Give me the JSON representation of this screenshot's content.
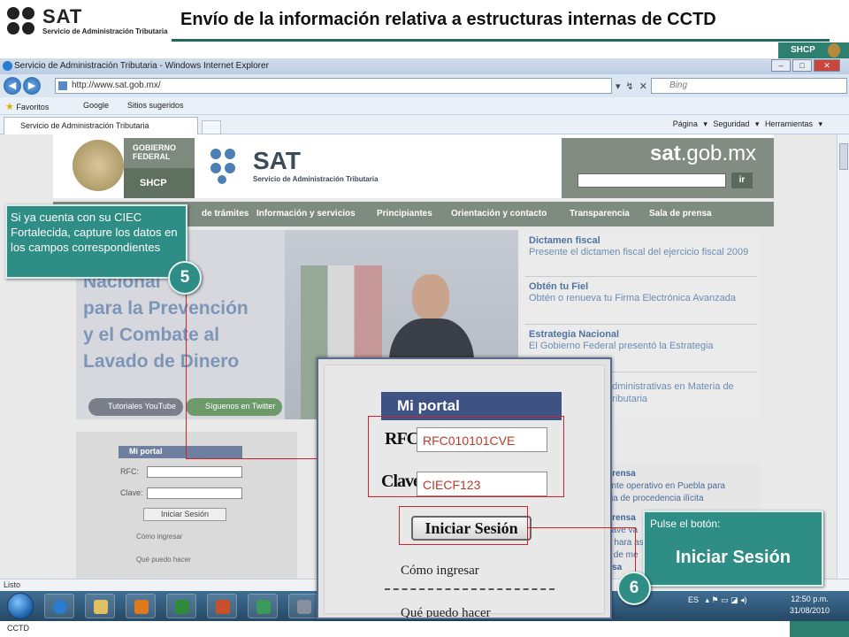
{
  "slide": {
    "logo_word": "SAT",
    "logo_sub": "Servicio de Administración Tributaria",
    "title": "Envío de la información relativa a estructuras internas de CCTD",
    "shcp_badge": "SHCP",
    "footer": "CCTD"
  },
  "browser": {
    "window_title": "Servicio de Administración Tributaria - Windows Internet Explorer",
    "url": "http://www.sat.gob.mx/",
    "search_placeholder": "Bing",
    "favorites": [
      "Favoritos",
      "Google",
      "Sitios sugeridos"
    ],
    "tab_title": "Servicio de Administración Tributaria",
    "command_bar": [
      "Página",
      "Seguridad",
      "Herramientas"
    ],
    "status": "Listo"
  },
  "site": {
    "gov_line1": "GOBIERNO",
    "gov_line2": "FEDERAL",
    "shcp": "SHCP",
    "logo_word": "SAT",
    "logo_sub": "Servicio de Administración Tributaria",
    "domain_bold": "sat",
    "domain_rest": ".gob.mx",
    "search_button": "ir",
    "nav": [
      "de trámites",
      "Información y servicios",
      "Principiantes",
      "Orientación y contacto",
      "Transparencia",
      "Sala de prensa"
    ],
    "hero_lines": [
      "Nacional",
      "para la Prevención",
      "y el Combate al",
      "Lavado de Dinero"
    ],
    "social": [
      "Tutoriales YouTube",
      "Síguenos en Twitter"
    ],
    "promos": [
      {
        "title": "Dictamen fiscal",
        "body": "Presente el dictamen fiscal del ejercicio fiscal 2009"
      },
      {
        "title": "Obtén tu Fiel",
        "body": "Obtén o renueva tu Firma Electrónica Avanzada"
      },
      {
        "title": "Estrategia Nacional",
        "body": "El Gobierno Federal presentó la Estrategia"
      },
      {
        "title": "",
        "body": "administrativas en Materia de"
      },
      {
        "title": "",
        "body": "Tributaria"
      }
    ],
    "lower_news": [
      "prensa",
      "ante operativo en Puebla para",
      "cia de procedencia ilícita",
      "prensa",
      "have va",
      "n hara ase",
      "s de me",
      "nsa"
    ],
    "portal_small": {
      "header": "Mi portal",
      "rfc_label": "RFC:",
      "clave_label": "Clave:",
      "button": "Iniciar Sesión",
      "link1": "Cómo ingresar",
      "link2": "Qué puedo hacer"
    }
  },
  "taskbar": {
    "lang": "ES",
    "time": "12:50 p.m.",
    "date": "31/08/2010"
  },
  "zoom_portal": {
    "header": "Mi portal",
    "rfc_label": "RFC:",
    "rfc_value": "RFC010101CVE",
    "clave_label": "Clave:",
    "clave_value": "CIECF123",
    "button": "Iniciar Sesión",
    "link1": "Cómo ingresar",
    "link2": "Qué puedo hacer"
  },
  "callouts": {
    "step1_number": "5",
    "step1_text": "Si ya cuenta con su CIEC Fortalecida, capture los datos en los campos correspondientes",
    "step2_number": "6",
    "step2_small": "Pulse el botón:",
    "step2_big": "Iniciar Sesión"
  },
  "colors": {
    "callout": "#2e8e86",
    "highlight": "#d0222a",
    "portal_header": "#3e5284",
    "brand_green": "#2f7f6e"
  }
}
